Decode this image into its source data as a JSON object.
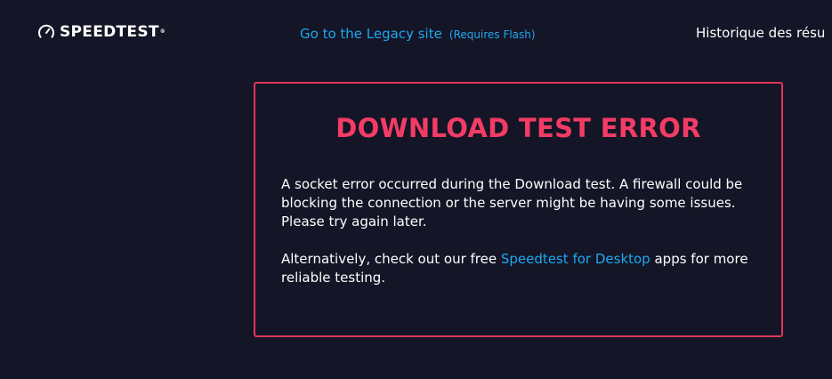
{
  "header": {
    "logo_text": "SPEEDTEST",
    "logo_tm": "®",
    "logo_icon": "speedometer-icon",
    "legacy_link": "Go to the Legacy site",
    "legacy_note": "(Requires Flash)",
    "history_link": "Historique des résu"
  },
  "error": {
    "title": "DOWNLOAD TEST ERROR",
    "message": "A socket error occurred during the Download test. A firewall could be blocking the connection or the server might be having some issues. Please try again later.",
    "alt_prefix": "Alternatively, check out our free ",
    "alt_link": "Speedtest for Desktop",
    "alt_suffix": " apps for more reliable testing."
  },
  "colors": {
    "background": "#141526",
    "accent_blue": "#1ea8f0",
    "error_red": "#f33c65",
    "border_red": "#e1365a"
  }
}
